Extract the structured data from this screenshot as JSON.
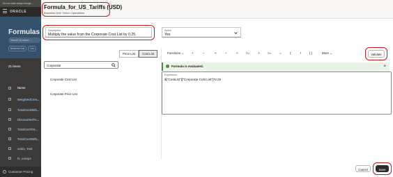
{
  "background": {
    "notice": "Do not make setup change...",
    "logo": "ORACLE",
    "page_title": "Formulas",
    "search_placeholder": "Search by name...",
    "filters": [
      "Business Unit",
      "Con"
    ],
    "item_count": "21 items",
    "column_header": "Name",
    "rows": [
      "WeightedCom...",
      "TotalCostWith...",
      "DiscountedTo...",
      "TotalCostTot...",
      "TotalCostWith...",
      "sshin_Test",
      "fs_comp3"
    ],
    "footer": "Customer Pricing"
  },
  "drawer": {
    "title": "Formula_for_US_Tariffs (USD)",
    "subtitle": "Business Unit: Vision Operations",
    "description": {
      "label": "Description",
      "value": "Multiply the value from the Corporate Cost List by 0.25."
    },
    "active": {
      "label": "Active",
      "value": "Yes"
    },
    "tabs": [
      "Price List",
      "Cost List"
    ],
    "search_value": "Corporate",
    "lists": [
      "Corporate Cost List",
      "Corporate Price List"
    ],
    "toolbar": {
      "functions": "Functions",
      "ops": [
        "+",
        "−",
        "×",
        "÷",
        "<",
        "<=",
        ">",
        ">=",
        "=",
        "(",
        "!",
        "{ }"
      ],
      "more": "More",
      "validate": "Validate"
    },
    "message": "Formula is evaluated.",
    "expression": {
      "label": "Expression",
      "value": "$[\"CostList\"][\"Corporate Cost List\"]*0.25"
    },
    "cancel": "Cancel",
    "save": "Save"
  },
  "colors": {
    "accent_highlight": "#c4161c",
    "success": "#4c8b3f",
    "primary_button": "#2b2a29"
  }
}
